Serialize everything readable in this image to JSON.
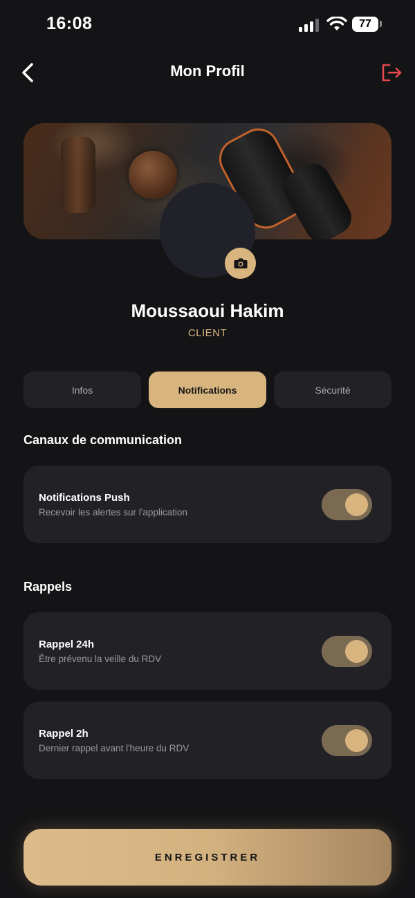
{
  "status_bar": {
    "time": "16:08",
    "battery": "77",
    "icons": [
      "signal-icon",
      "wifi-icon",
      "battery-icon"
    ]
  },
  "header": {
    "title": "Mon Profil",
    "back_icon": "chevron-left-icon",
    "logout_icon": "logout-icon"
  },
  "profile": {
    "name": "Moussaoui Hakim",
    "role": "CLIENT",
    "camera_icon": "camera-icon"
  },
  "tabs": [
    {
      "label": "Infos",
      "active": false
    },
    {
      "label": "Notifications",
      "active": true
    },
    {
      "label": "Sécurité",
      "active": false
    }
  ],
  "sections": {
    "channels": {
      "title": "Canaux de communication",
      "items": [
        {
          "title": "Notifications Push",
          "subtitle": "Recevoir les alertes sur l'application",
          "enabled": true
        }
      ]
    },
    "reminders": {
      "title": "Rappels",
      "items": [
        {
          "title": "Rappel 24h",
          "subtitle": "Être prévenu la veille du RDV",
          "enabled": true
        },
        {
          "title": "Rappel 2h",
          "subtitle": "Dernier rappel avant l'heure du RDV",
          "enabled": true
        }
      ]
    }
  },
  "save_label": "ENREGISTRER",
  "colors": {
    "background": "#141416",
    "card": "#222226",
    "accent": "#d8b47f",
    "logout": "#e5484d",
    "toggle_track": "#7a6a52"
  }
}
